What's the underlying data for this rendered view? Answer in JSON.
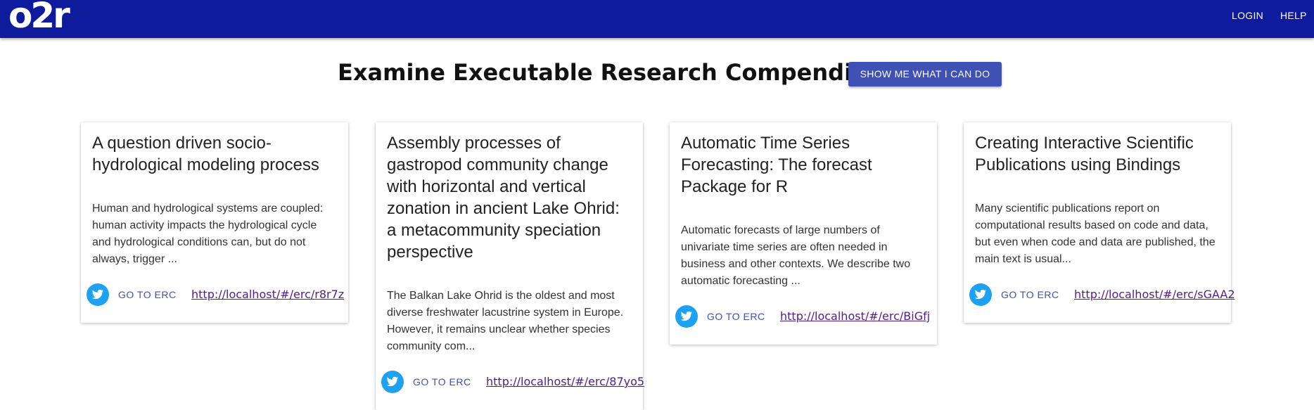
{
  "header": {
    "logo_text": "o2r",
    "nav": [
      {
        "label": "LOGIN"
      },
      {
        "label": "HELP"
      }
    ],
    "background_color": "#0d1b9c"
  },
  "main": {
    "title": "Examine Executable Research Compendia",
    "show_button_label": "SHOW ME WHAT I CAN DO",
    "accent_color": "#3f51b5"
  },
  "cards": [
    {
      "title": "A question driven socio-hydrological modeling process",
      "description": "Human and hydrological systems are coupled: human activity impacts the hydrological cycle and hydrological conditions can, but do not always, trigger ...",
      "share_icon": "twitter-icon",
      "go_label": "GO TO ERC",
      "url": "http://localhost/#/erc/r8r7z"
    },
    {
      "title": "Assembly processes of gastropod community change with horizontal and vertical zonation in ancient Lake Ohrid: a metacommunity speciation perspective",
      "description": "The Balkan Lake Ohrid is the oldest and most diverse freshwater lacustrine system in Europe. However, it remains unclear whether species community com...",
      "share_icon": "twitter-icon",
      "go_label": "GO TO ERC",
      "url": "http://localhost/#/erc/87yo5"
    },
    {
      "title": "Automatic Time Series Forecasting: The forecast Package for R",
      "description": "Automatic forecasts of large numbers of univariate time series are often needed in business and other contexts. We describe two automatic forecasting ...",
      "share_icon": "twitter-icon",
      "go_label": "GO TO ERC",
      "url": "http://localhost/#/erc/BiGfj"
    },
    {
      "title": "Creating Interactive Scientific Publications using Bindings",
      "description": "Many scientific publications report on computational results based on code and data, but even when code and data are published, the main text is usual...",
      "share_icon": "twitter-icon",
      "go_label": "GO TO ERC",
      "url": "http://localhost/#/erc/sGAA2"
    }
  ]
}
